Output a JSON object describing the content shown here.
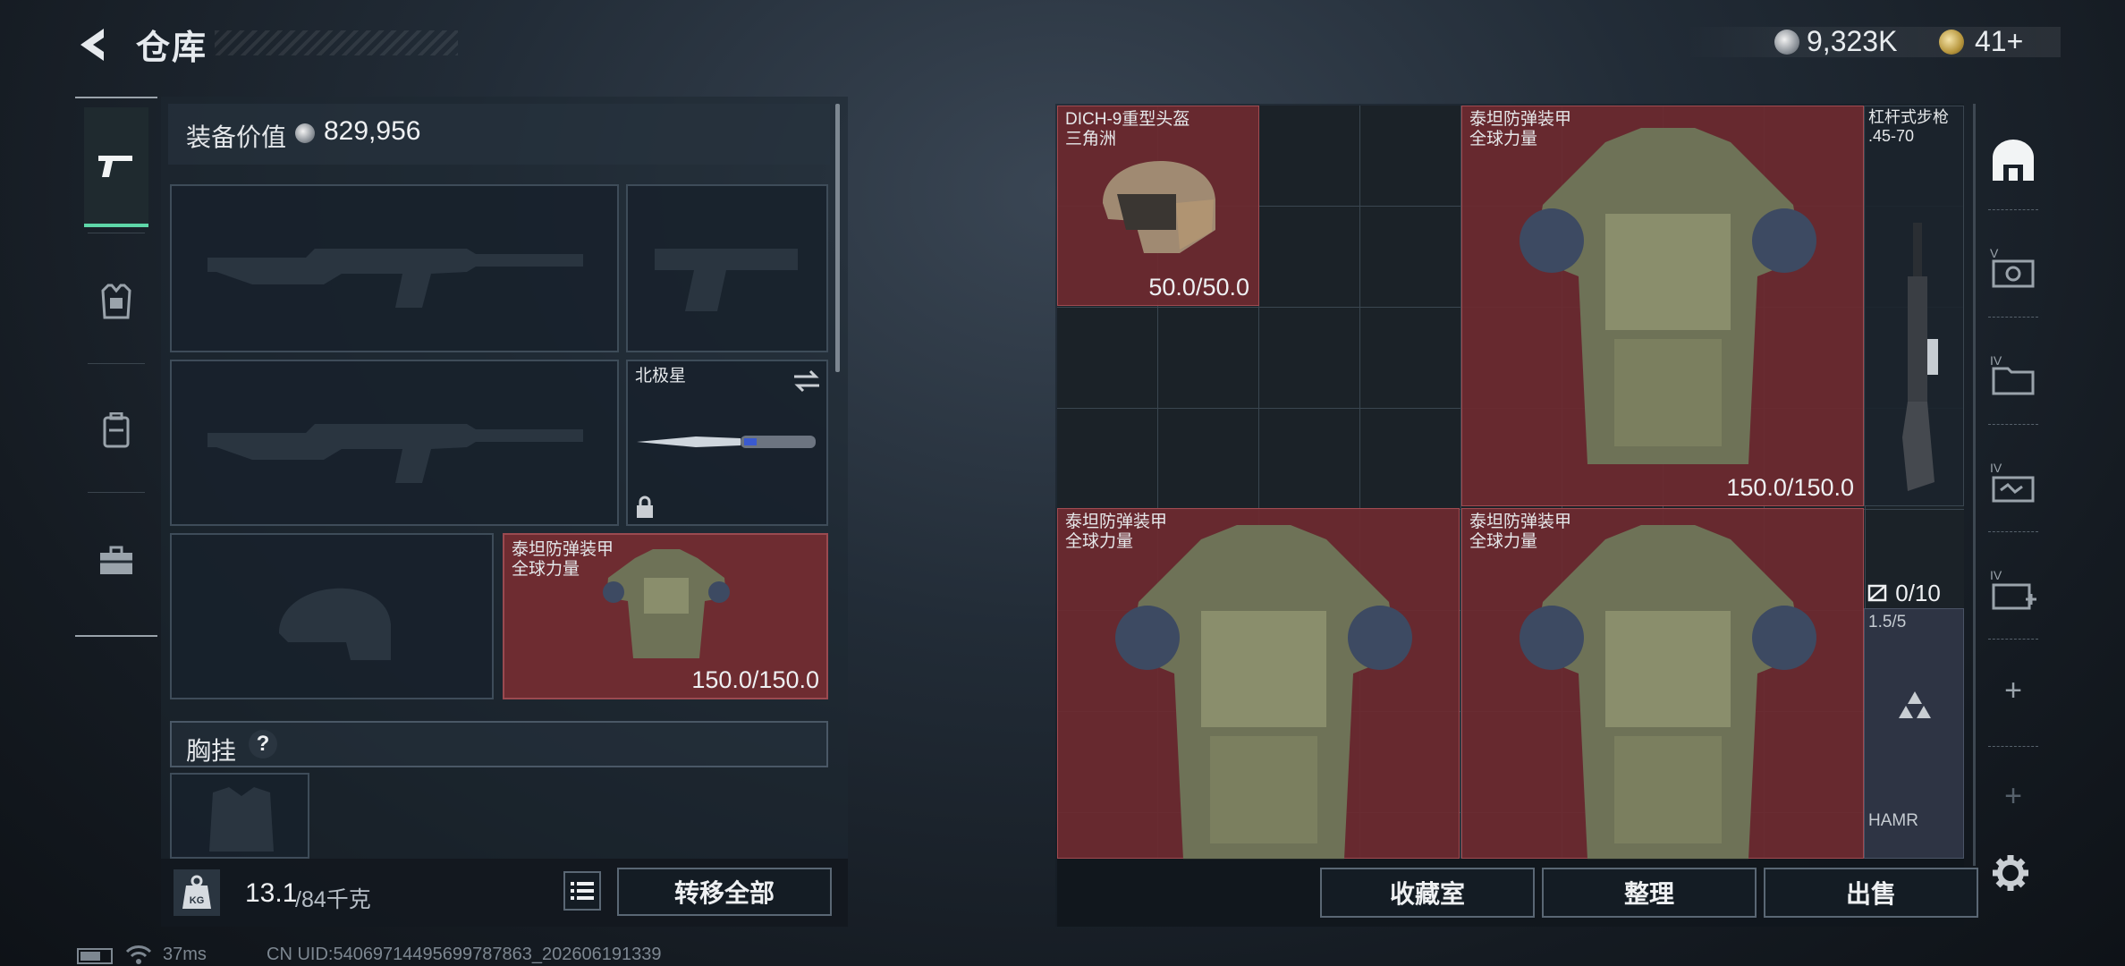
{
  "header": {
    "title": "仓库"
  },
  "currency": {
    "coins": "9,323K",
    "tokens": "41+"
  },
  "equipment": {
    "value_label": "装备价值",
    "value": "829,956",
    "knife_name": "北极星",
    "armor_name": "泰坦防弹装甲",
    "armor_sub": "全球力量",
    "armor_durability": "150.0/150.0",
    "chest_rig_label": "胸挂",
    "help_glyph": "?",
    "weight_value": "13.1",
    "weight_max": "/84千克",
    "weight_icon_text": "KG",
    "transfer_all": "转移全部"
  },
  "storage": {
    "helmet_name": "DICH-9重型头盔",
    "helmet_sub": "三角洲",
    "helmet_durability": "50.0/50.0",
    "armor1_name": "泰坦防弹装甲",
    "armor1_sub": "全球力量",
    "armor1_durability": "150.0/150.0",
    "armor2_name": "泰坦防弹装甲",
    "armor2_sub": "全球力量",
    "armor3_name": "泰坦防弹装甲",
    "armor3_sub": "全球力量",
    "rifle_name": "杠杆式步枪",
    "rifle_caliber": ".45-70",
    "ammo_count": "0/10",
    "scope_ratio": "1.5/5",
    "scope_name": "HAMR",
    "collection_btn": "收藏室",
    "sort_btn": "整理",
    "sell_btn": "出售"
  },
  "sidebar_right": {
    "roman_v": "V",
    "roman_iv_1": "IV",
    "roman_iv_2": "IV",
    "roman_iv_3": "IV"
  },
  "footer": {
    "ping": "37ms",
    "uid": "CN UID:5406971449569978786​3_202606191339"
  },
  "colors": {
    "accent_green": "#5ed7a8",
    "item_red": "#6e2c31",
    "panel_bg": "#18212b"
  }
}
